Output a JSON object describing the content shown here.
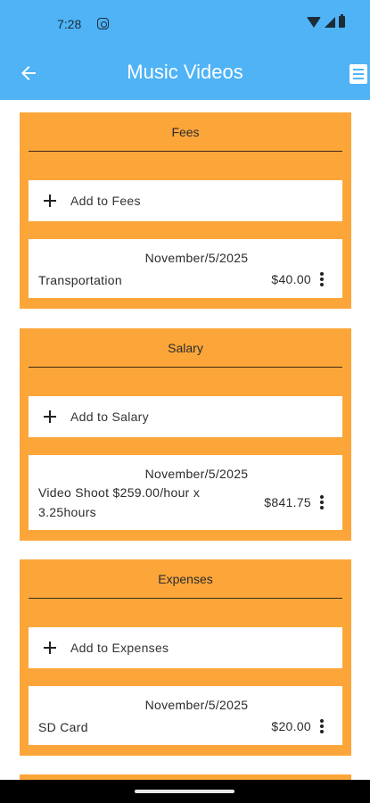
{
  "status_bar": {
    "time": "7:28"
  },
  "app_bar": {
    "title": "Music Videos"
  },
  "sections": [
    {
      "title": "Fees",
      "add_label": "Add to Fees",
      "entry": {
        "date": "November/5/2025",
        "description": "Transportation",
        "amount": "$40.00"
      }
    },
    {
      "title": "Salary",
      "add_label": "Add to Salary",
      "entry": {
        "date": "November/5/2025",
        "description": "Video Shoot $259.00/hour x 3.25hours",
        "amount": "$841.75"
      }
    },
    {
      "title": "Expenses",
      "add_label": "Add to Expenses",
      "entry": {
        "date": "November/5/2025",
        "description": "SD Card",
        "amount": "$20.00"
      }
    }
  ],
  "colors": {
    "app_bar": "#4fb3f6",
    "section_bg": "#fca63a",
    "card_bg": "#ffffff"
  }
}
